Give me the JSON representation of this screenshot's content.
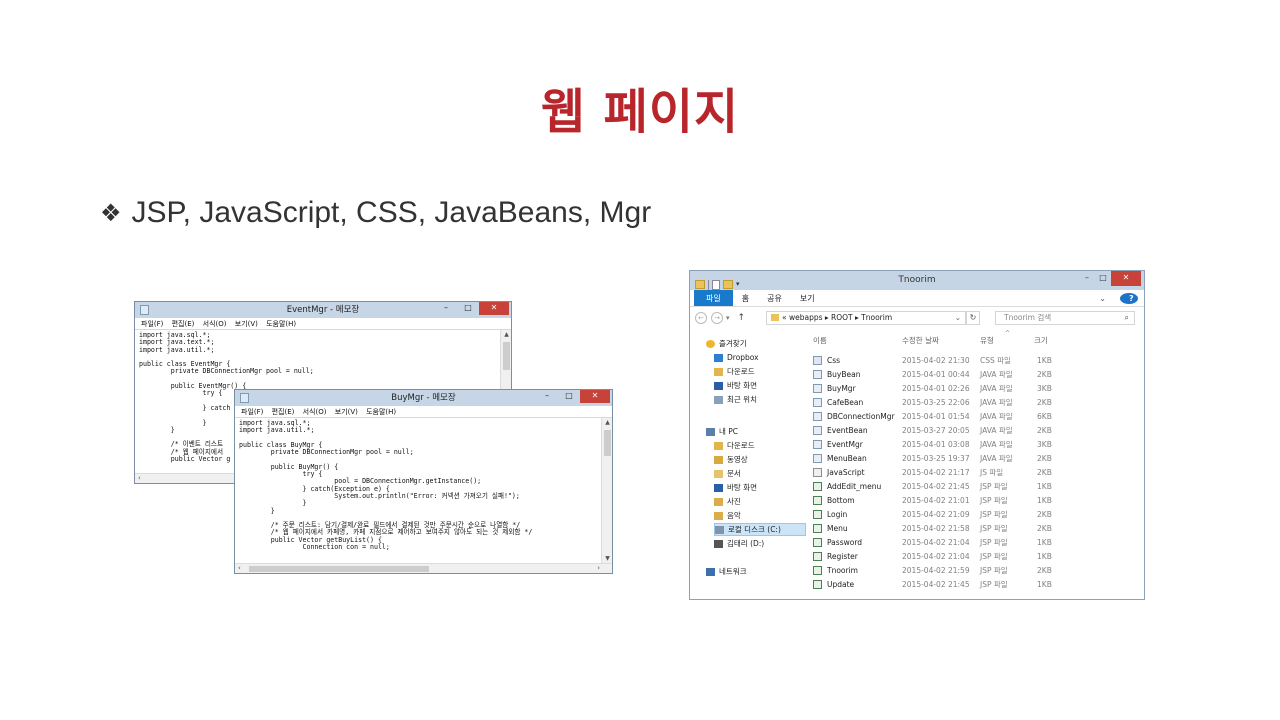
{
  "slide": {
    "title": "웹 페이지",
    "bullet_glyph": "❖",
    "bullet_text": "JSP, JavaScript, CSS, JavaBeans, Mgr"
  },
  "event_notepad": {
    "title": "EventMgr - 메모장",
    "menu": [
      "파일(F)",
      "편집(E)",
      "서식(O)",
      "보기(V)",
      "도움말(H)"
    ],
    "lines": [
      "import java.sql.*;",
      "import java.text.*;",
      "import java.util.*;",
      "",
      "public class EventMgr {",
      "        private DBConnectionMgr pool = null;",
      "",
      "        public EventMgr() {",
      "                try {",
      "",
      "                } catch",
      "",
      "                }",
      "        }",
      "",
      "        /* 이벤트 리스트",
      "        /* 웹 페이지에서",
      "        public Vector g"
    ]
  },
  "buy_notepad": {
    "title": "BuyMgr - 메모장",
    "menu": [
      "파일(F)",
      "편집(E)",
      "서식(O)",
      "보기(V)",
      "도움말(H)"
    ],
    "lines": [
      "import java.sql.*;",
      "import java.util.*;",
      "",
      "public class BuyMgr {",
      "        private DBConnectionMgr pool = null;",
      "",
      "        public BuyMgr() {",
      "                try {",
      "                        pool = DBConnectionMgr.getInstance();",
      "                } catch(Exception e) {",
      "                        System.out.println(\"Error: 커넥션 가져오기 실패!\");",
      "                }",
      "        }",
      "",
      "        /* 주문 리스트: 담기/결제/완료 필드에서 결제된 것만 주문시간 순으로 나열함 */",
      "        /* 웹 페이지에서 카페명, 카페 지점으로 제어하고 보여주지 않아도 되는 것 제외함 */",
      "        public Vector getBuyList() {",
      "                Connection con = null;"
    ]
  },
  "window_controls": {
    "minimize": "–",
    "maximize": "□",
    "close": "✕"
  },
  "explorer": {
    "title": "Tnoorim",
    "ribbon_tabs": [
      "파일",
      "홈",
      "공유",
      "보기"
    ],
    "help": "?",
    "address_path": "« webapps ▸ ROOT ▸ Tnoorim",
    "search_placeholder": "Tnoorim 검색",
    "columns": {
      "name": "이름",
      "date": "수정한 날짜",
      "type": "유형",
      "size": "크기"
    },
    "nav": [
      {
        "label": "즐겨찾기",
        "icon": "star-icon",
        "indent": 0
      },
      {
        "label": "Dropbox",
        "icon": "dropbox-icon",
        "indent": 1
      },
      {
        "label": "다운로드",
        "icon": "downloads-folder-icon",
        "indent": 1
      },
      {
        "label": "바탕 화면",
        "icon": "desktop-icon",
        "indent": 1
      },
      {
        "label": "최근 위치",
        "icon": "recent-places-icon",
        "indent": 1
      },
      {
        "label": "내 PC",
        "icon": "computer-icon",
        "indent": 0
      },
      {
        "label": "다운로드",
        "icon": "downloads-folder-icon",
        "indent": 1
      },
      {
        "label": "동영상",
        "icon": "videos-folder-icon",
        "indent": 1
      },
      {
        "label": "문서",
        "icon": "documents-folder-icon",
        "indent": 1
      },
      {
        "label": "바탕 화면",
        "icon": "desktop-icon",
        "indent": 1
      },
      {
        "label": "사진",
        "icon": "pictures-folder-icon",
        "indent": 1
      },
      {
        "label": "음악",
        "icon": "music-folder-icon",
        "indent": 1
      },
      {
        "label": "로컬 디스크 (C:)",
        "icon": "local-disk-icon",
        "indent": 1,
        "selected": true
      },
      {
        "label": "김태리 (D:)",
        "icon": "drive-icon",
        "indent": 1
      },
      {
        "label": "네트워크",
        "icon": "network-icon",
        "indent": 0
      }
    ],
    "files": [
      {
        "name": "Css",
        "date": "2015-04-02 21:30",
        "type": "CSS 파일",
        "size": "1KB",
        "icon": "css"
      },
      {
        "name": "BuyBean",
        "date": "2015-04-01 00:44",
        "type": "JAVA 파일",
        "size": "2KB",
        "icon": "java"
      },
      {
        "name": "BuyMgr",
        "date": "2015-04-01 02:26",
        "type": "JAVA 파일",
        "size": "3KB",
        "icon": "java"
      },
      {
        "name": "CafeBean",
        "date": "2015-03-25 22:06",
        "type": "JAVA 파일",
        "size": "2KB",
        "icon": "java"
      },
      {
        "name": "DBConnectionMgr",
        "date": "2015-04-01 01:54",
        "type": "JAVA 파일",
        "size": "6KB",
        "icon": "java"
      },
      {
        "name": "EventBean",
        "date": "2015-03-27 20:05",
        "type": "JAVA 파일",
        "size": "2KB",
        "icon": "java"
      },
      {
        "name": "EventMgr",
        "date": "2015-04-01 03:08",
        "type": "JAVA 파일",
        "size": "3KB",
        "icon": "java"
      },
      {
        "name": "MenuBean",
        "date": "2015-03-25 19:37",
        "type": "JAVA 파일",
        "size": "2KB",
        "icon": "java"
      },
      {
        "name": "JavaScript",
        "date": "2015-04-02 21:17",
        "type": "JS 파일",
        "size": "2KB",
        "icon": "js"
      },
      {
        "name": "AddEdit_menu",
        "date": "2015-04-02 21:45",
        "type": "JSP 파일",
        "size": "1KB",
        "icon": "jsp"
      },
      {
        "name": "Bottom",
        "date": "2015-04-02 21:01",
        "type": "JSP 파일",
        "size": "1KB",
        "icon": "jsp"
      },
      {
        "name": "Login",
        "date": "2015-04-02 21:09",
        "type": "JSP 파일",
        "size": "2KB",
        "icon": "jsp"
      },
      {
        "name": "Menu",
        "date": "2015-04-02 21:58",
        "type": "JSP 파일",
        "size": "2KB",
        "icon": "jsp"
      },
      {
        "name": "Password",
        "date": "2015-04-02 21:04",
        "type": "JSP 파일",
        "size": "1KB",
        "icon": "jsp"
      },
      {
        "name": "Register",
        "date": "2015-04-02 21:04",
        "type": "JSP 파일",
        "size": "1KB",
        "icon": "jsp"
      },
      {
        "name": "Tnoorim",
        "date": "2015-04-02 21:59",
        "type": "JSP 파일",
        "size": "2KB",
        "icon": "jsp"
      },
      {
        "name": "Update",
        "date": "2015-04-02 21:45",
        "type": "JSP 파일",
        "size": "1KB",
        "icon": "jsp"
      }
    ]
  }
}
